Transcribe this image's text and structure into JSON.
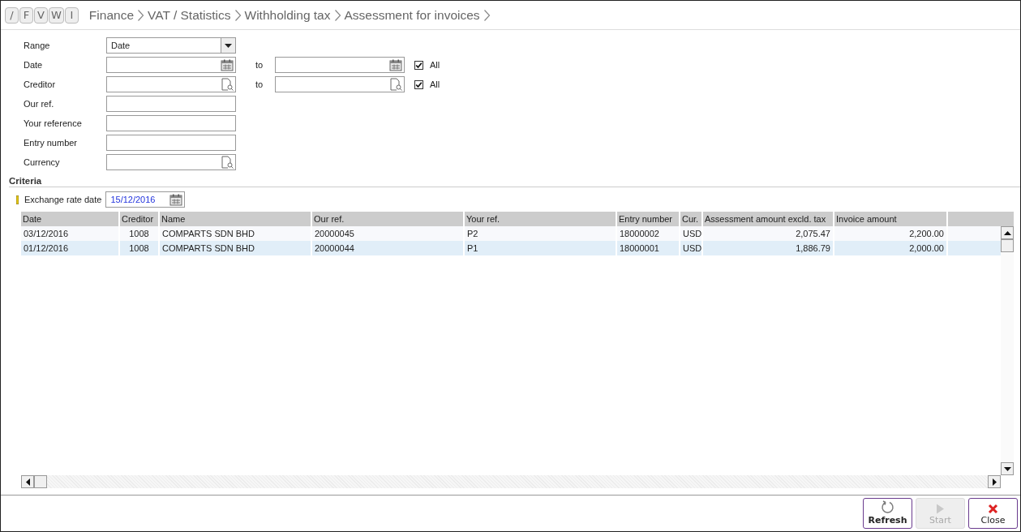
{
  "nav_buttons": [
    "/",
    "F",
    "V",
    "W",
    "I"
  ],
  "breadcrumb": [
    "Finance",
    "VAT / Statistics",
    "Withholding tax",
    "Assessment for invoices"
  ],
  "form": [
    {
      "label": "Range",
      "kind": "dropdown",
      "value": "Date"
    },
    {
      "label": "Date",
      "kind": "date",
      "to": {
        "label": "to",
        "kind": "date"
      },
      "all": {
        "label": "All",
        "checked": true
      }
    },
    {
      "label": "Creditor",
      "kind": "lookup",
      "to": {
        "label": "to",
        "kind": "lookup"
      },
      "all": {
        "label": "All",
        "checked": true
      }
    },
    {
      "label": "Our ref.",
      "kind": "text"
    },
    {
      "label": "Your reference",
      "kind": "text"
    },
    {
      "label": "Entry number",
      "kind": "text"
    },
    {
      "label": "Currency",
      "kind": "lookup"
    }
  ],
  "criteria": {
    "title": "Criteria",
    "fields": [
      {
        "label": "Exchange rate date",
        "kind": "date",
        "value": "15/12/2016",
        "required": true
      }
    ]
  },
  "table": {
    "columns": [
      "Date",
      "Creditor",
      "Name",
      "Our ref.",
      "Your ref.",
      "Entry number",
      "Cur.",
      "Assessment amount excld. tax",
      "Invoice amount"
    ],
    "rows": [
      {
        "selected": false,
        "cells": [
          "03/12/2016",
          "1008",
          "COMPARTS SDN BHD",
          "20000045",
          "P2",
          "18000002",
          "USD",
          "2,075.47",
          "2,200.00"
        ]
      },
      {
        "selected": true,
        "cells": [
          "01/12/2016",
          "1008",
          "COMPARTS SDN BHD",
          "20000044",
          "P1",
          "18000001",
          "USD",
          "1,886.79",
          "2,000.00"
        ]
      }
    ]
  },
  "buttons": [
    {
      "label": "Refresh",
      "kind": "refresh",
      "disabled": false
    },
    {
      "label": "Start",
      "kind": "start",
      "disabled": true
    },
    {
      "label": "Close",
      "kind": "close",
      "disabled": false
    }
  ]
}
